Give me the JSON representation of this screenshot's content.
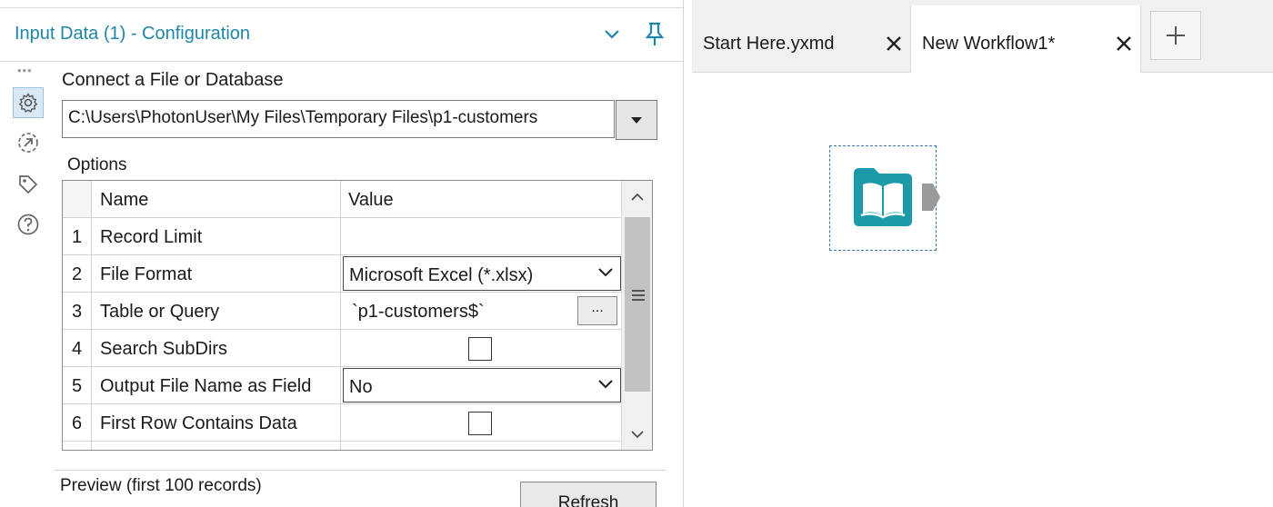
{
  "config": {
    "title": "Input Data (1) - Configuration",
    "connect_label": "Connect a File or Database",
    "file_path": "C:\\Users\\PhotonUser\\My Files\\Temporary Files\\p1-customers",
    "options_label": "Options",
    "grid": {
      "headers": {
        "name": "Name",
        "value": "Value"
      },
      "rows": [
        {
          "num": "1",
          "name": "Record Limit",
          "value": ""
        },
        {
          "num": "2",
          "name": "File Format",
          "value": "Microsoft Excel (*.xlsx)"
        },
        {
          "num": "3",
          "name": "Table or Query",
          "value": "`p1-customers$`",
          "button": "..."
        },
        {
          "num": "4",
          "name": "Search SubDirs",
          "checked": false
        },
        {
          "num": "5",
          "name": "Output File Name as Field",
          "value": "No"
        },
        {
          "num": "6",
          "name": "First Row Contains Data",
          "checked": false
        }
      ]
    },
    "preview_label": "Preview (first 100 records)",
    "refresh_label": "Refresh"
  },
  "side_rail": {
    "icons": [
      "settings-icon",
      "navigate-icon",
      "tag-icon",
      "help-icon"
    ],
    "active": "settings-icon"
  },
  "workflow": {
    "tabs": [
      {
        "label": "Start Here.yxmd",
        "active": false
      },
      {
        "label": "New Workflow1*",
        "active": true
      }
    ],
    "tool": {
      "name": "input-data-tool",
      "icon": "book-icon"
    }
  },
  "colors": {
    "title_blue": "#1e86a6",
    "tool_teal": "#1c9aa8",
    "selection_blue": "#3a78b0"
  }
}
